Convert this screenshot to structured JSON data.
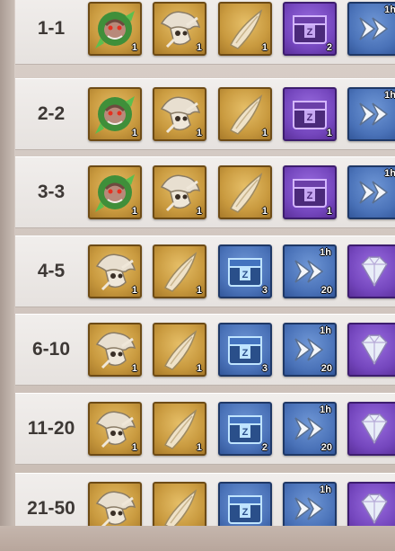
{
  "colors": {
    "gold_frame": "#c99a3f",
    "purple_frame": "#7446bd",
    "blue_frame": "#4a72b8",
    "rank_text": "#3d3835"
  },
  "rows": [
    {
      "rank": "1-1",
      "items": [
        {
          "icon": "raptor-head-icon",
          "frame": "gold",
          "qty": "1"
        },
        {
          "icon": "triceratops-skull-icon",
          "frame": "gold",
          "qty": "1"
        },
        {
          "icon": "horn-tusk-icon",
          "frame": "gold",
          "qty": "1"
        },
        {
          "icon": "purple-chest-icon",
          "frame": "purple",
          "qty": "2"
        },
        {
          "icon": "speedup-icon",
          "frame": "blue",
          "tag": "1h",
          "qty": ""
        }
      ]
    },
    {
      "rank": "2-2",
      "items": [
        {
          "icon": "raptor-head-icon",
          "frame": "gold",
          "qty": "1"
        },
        {
          "icon": "triceratops-skull-icon",
          "frame": "gold",
          "qty": "1"
        },
        {
          "icon": "horn-tusk-icon",
          "frame": "gold",
          "qty": "1"
        },
        {
          "icon": "purple-chest-icon",
          "frame": "purple",
          "qty": "1"
        },
        {
          "icon": "speedup-icon",
          "frame": "blue",
          "tag": "1h",
          "qty": ""
        }
      ]
    },
    {
      "rank": "3-3",
      "items": [
        {
          "icon": "raptor-head-icon",
          "frame": "gold",
          "qty": "1"
        },
        {
          "icon": "triceratops-skull-icon",
          "frame": "gold",
          "qty": "1"
        },
        {
          "icon": "horn-tusk-icon",
          "frame": "gold",
          "qty": "1"
        },
        {
          "icon": "purple-chest-icon",
          "frame": "purple",
          "qty": "1"
        },
        {
          "icon": "speedup-icon",
          "frame": "blue",
          "tag": "1h",
          "qty": ""
        }
      ]
    },
    {
      "rank": "4-5",
      "items": [
        {
          "icon": "triceratops-skull-icon",
          "frame": "gold",
          "qty": "1"
        },
        {
          "icon": "horn-tusk-icon",
          "frame": "gold",
          "qty": "1"
        },
        {
          "icon": "blue-chest-icon",
          "frame": "blue",
          "qty": "3"
        },
        {
          "icon": "speedup-icon",
          "frame": "blue",
          "tag": "1h",
          "qty": "20"
        },
        {
          "icon": "diamond-icon",
          "frame": "purple",
          "qty": ""
        }
      ]
    },
    {
      "rank": "6-10",
      "items": [
        {
          "icon": "triceratops-skull-icon",
          "frame": "gold",
          "qty": "1"
        },
        {
          "icon": "horn-tusk-icon",
          "frame": "gold",
          "qty": "1"
        },
        {
          "icon": "blue-chest-icon",
          "frame": "blue",
          "qty": "3"
        },
        {
          "icon": "speedup-icon",
          "frame": "blue",
          "tag": "1h",
          "qty": "20"
        },
        {
          "icon": "diamond-icon",
          "frame": "purple",
          "qty": ""
        }
      ]
    },
    {
      "rank": "11-20",
      "items": [
        {
          "icon": "triceratops-skull-icon",
          "frame": "gold",
          "qty": "1"
        },
        {
          "icon": "horn-tusk-icon",
          "frame": "gold",
          "qty": "1"
        },
        {
          "icon": "blue-chest-icon",
          "frame": "blue",
          "qty": "2"
        },
        {
          "icon": "speedup-icon",
          "frame": "blue",
          "tag": "1h",
          "qty": "20"
        },
        {
          "icon": "diamond-icon",
          "frame": "purple",
          "qty": ""
        }
      ]
    },
    {
      "rank": "21-50",
      "items": [
        {
          "icon": "triceratops-skull-icon",
          "frame": "gold",
          "qty": ""
        },
        {
          "icon": "horn-tusk-icon",
          "frame": "gold",
          "qty": ""
        },
        {
          "icon": "blue-chest-icon",
          "frame": "blue",
          "qty": ""
        },
        {
          "icon": "speedup-icon",
          "frame": "blue",
          "tag": "1h",
          "qty": ""
        },
        {
          "icon": "diamond-icon",
          "frame": "purple",
          "qty": ""
        }
      ]
    }
  ]
}
